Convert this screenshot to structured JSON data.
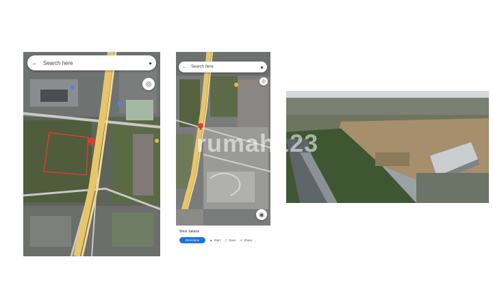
{
  "map_left": {
    "search_placeholder": "Search here",
    "icons": [
      "back-arrow-icon",
      "mic-icon",
      "compass-icon",
      "location-pin-icon"
    ]
  },
  "map_right": {
    "search_placeholder": "Search here",
    "place_title": "West Jakarta",
    "actions": [
      "Directions",
      "Start",
      "Save",
      "Share"
    ],
    "icons": [
      "back-arrow-icon",
      "mic-icon",
      "compass-icon",
      "location-pin-icon",
      "my-location-icon"
    ]
  },
  "watermark": "rumah123",
  "colors": {
    "road": "#e8c56a",
    "lot_outline": "#e53935",
    "pin": "#e53935",
    "button": "#1a73e8"
  }
}
